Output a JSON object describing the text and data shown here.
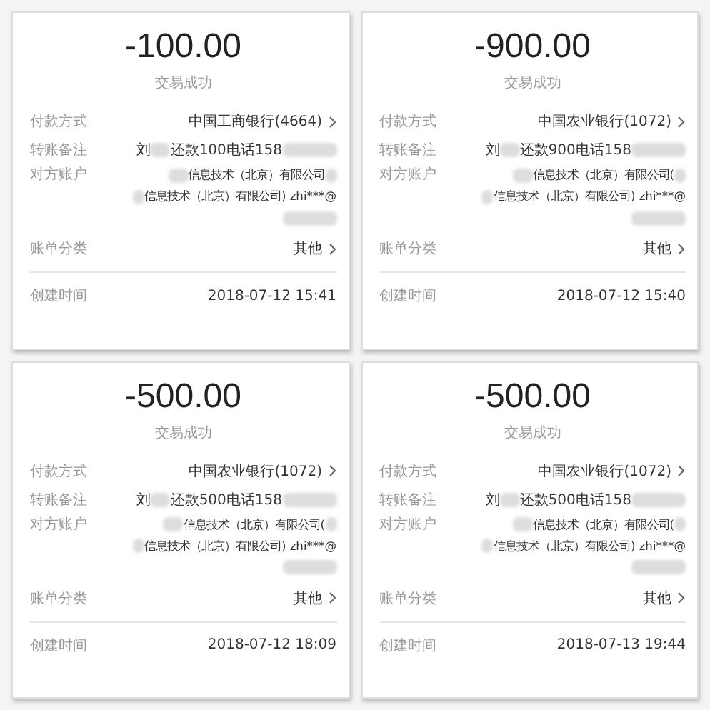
{
  "receipts": [
    {
      "amount": "-100.00",
      "status": "交易成功",
      "payment_label": "付款方式",
      "payment_value": "中国工商银行(4664)",
      "remark_label": "转账备注",
      "remark_before": "刘",
      "remark_after": "还款100电话158",
      "account_label": "对方账户",
      "account_line1": "信息技术（北京）有限公司",
      "account_line2": "信息技术（北京）有限公司) zhi***@",
      "category_label": "账单分类",
      "category_value": "其他",
      "time_label": "创建时间",
      "time_value": "2018-07-12 15:41"
    },
    {
      "amount": "-900.00",
      "status": "交易成功",
      "payment_label": "付款方式",
      "payment_value": "中国农业银行(1072)",
      "remark_label": "转账备注",
      "remark_before": "刘",
      "remark_after": "还款900电话158",
      "account_label": "对方账户",
      "account_line1": "信息技术（北京）有限公司(",
      "account_line2": "信息技术（北京）有限公司) zhi***@",
      "category_label": "账单分类",
      "category_value": "其他",
      "time_label": "创建时间",
      "time_value": "2018-07-12 15:40"
    },
    {
      "amount": "-500.00",
      "status": "交易成功",
      "payment_label": "付款方式",
      "payment_value": "中国农业银行(1072)",
      "remark_label": "转账备注",
      "remark_before": "刘",
      "remark_after": "还款500电话158",
      "account_label": "对方账户",
      "account_line1": "信息技术（北京）有限公司(",
      "account_line2": "信息技术（北京）有限公司) zhi***@",
      "category_label": "账单分类",
      "category_value": "其他",
      "time_label": "创建时间",
      "time_value": "2018-07-12 18:09"
    },
    {
      "amount": "-500.00",
      "status": "交易成功",
      "payment_label": "付款方式",
      "payment_value": "中国农业银行(1072)",
      "remark_label": "转账备注",
      "remark_before": "刘",
      "remark_after": "还款500电话158",
      "account_label": "对方账户",
      "account_line1": "信息技术（北京）有限公司(",
      "account_line2": "信息技术（北京）有限公司) zhi***@",
      "category_label": "账单分类",
      "category_value": "其他",
      "time_label": "创建时间",
      "time_value": "2018-07-13 19:44"
    }
  ]
}
